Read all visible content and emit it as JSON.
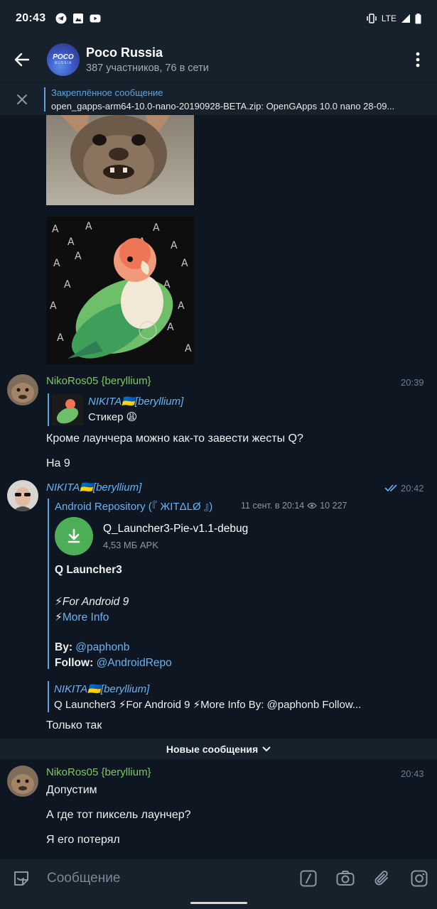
{
  "status_bar": {
    "time": "20:43",
    "network": "LTE"
  },
  "header": {
    "title": "Poco Russia",
    "subtitle": "387 участников, 76 в сети",
    "avatar_logo_top": "POCO",
    "avatar_logo_bottom": "RUSSIA"
  },
  "pinned": {
    "title": "Закреплённое сообщение",
    "text": "open_gapps-arm64-10.0-nano-20190928-BETA.zip: OpenGApps 10.0 nano 28-09..."
  },
  "messages": {
    "m1": {
      "name": "NikoRos05 {beryllium}",
      "time": "20:39",
      "reply_name": "NIKITA🇺🇦[beryllium]",
      "reply_text": "Стикер 😩",
      "line1": "Кроме лаунчера можно как-то завести жесты Q?",
      "line2": "На 9"
    },
    "m2": {
      "name": "NIKITA🇺🇦[beryllium]",
      "time": "20:42",
      "forward_from": "Android Repository (『 ЖITΔLØ 』)",
      "forward_date": "11 сент. в 20:14",
      "views": "10 227",
      "file_name": "Q_Launcher3-Pie-v1.1-debug",
      "file_meta": "4,53 МБ APK",
      "caption_title": "Q Launcher3",
      "caption_line1": "⚡For Android 9",
      "caption_line2_emoji": "⚡",
      "caption_line2_link": "More Info",
      "by_label": "By:",
      "by_value": "@paphonb",
      "follow_label": "Follow:",
      "follow_value": "@AndroidRepo",
      "reply_name": "NIKITA🇺🇦[beryllium]",
      "reply_text": "Q Launcher3  ⚡For Android 9 ⚡More Info  By: @paphonb Follow...",
      "text": "Только так"
    },
    "new_messages_label": "Новые сообщения",
    "m3": {
      "name": "NikoRos05 {beryllium}",
      "time": "20:43",
      "line1": "Допустим",
      "line2": "А где тот пиксель лаунчер?",
      "line3": "Я его потерял"
    }
  },
  "input": {
    "placeholder": "Сообщение"
  },
  "colors": {
    "background": "#0e1621",
    "panel": "#17212b",
    "accent_blue": "#6ab3f3",
    "name_green": "#7bc862",
    "file_green": "#4caf58"
  }
}
